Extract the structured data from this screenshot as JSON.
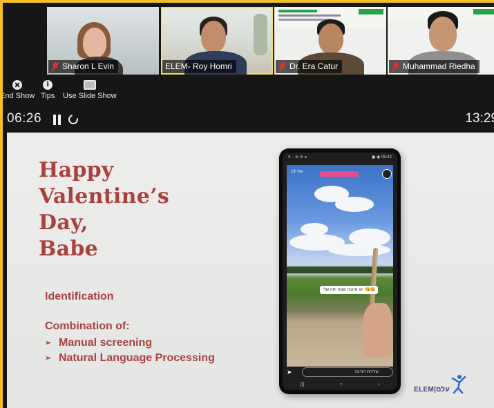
{
  "participants": [
    {
      "name": "Sharon L Evin",
      "muted": true
    },
    {
      "name": "ELEM- Roy Homri",
      "muted": false,
      "active_speaker": true
    },
    {
      "name": "Dr. Era Catur",
      "muted": true
    },
    {
      "name": "Muhammad Riedha",
      "muted": true
    }
  ],
  "toolbar": {
    "end_show_label": "End Show",
    "tips_label": "Tips",
    "slide_show_label": "Use Slide Show"
  },
  "presenter": {
    "elapsed_time": "06:26",
    "clock_time": "13:29"
  },
  "slide": {
    "headline": [
      "Happy",
      "Valentine’s",
      "Day,",
      "Babe"
    ],
    "section_title": "Identification",
    "combination_label": "Combination of:",
    "bullets": [
      "Manual screening",
      "Natural Language Processing"
    ],
    "logo_text": "ELEM|עלם"
  },
  "phone_story": {
    "status_left": "4 .. ≋ ≋ ◂",
    "status_right": "▣ ◉ 05:42",
    "username": "שלי 19",
    "caption": "יום אהבה שמח יפה שלי 😘😘",
    "reply_placeholder": "שליחת הודעה",
    "nav_recent": "|||",
    "nav_home": "○",
    "nav_back": "›"
  },
  "colors": {
    "accent_frame": "#f2c02a",
    "headline": "#a8423f",
    "active_speaker": "#f5e34a",
    "mute_icon": "#e03030"
  }
}
